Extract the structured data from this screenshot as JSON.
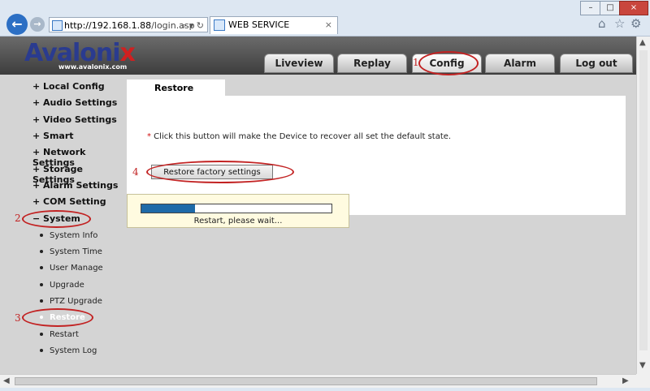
{
  "browser": {
    "url_host": "http://192.168.1.88",
    "url_path": "/login.asp",
    "address_controls": "⌕ ▾ ↻",
    "tab_title": "WEB SERVICE",
    "tab_close": "×",
    "window_controls": [
      "–",
      "□",
      "×"
    ],
    "toolbar_icons": [
      "home-icon",
      "star-icon",
      "gear-icon"
    ]
  },
  "header": {
    "logo_main": "Avaloni",
    "logo_x": "x",
    "logo_url": "www.avalonix.com",
    "tabs": [
      "Liveview",
      "Replay",
      "Config",
      "Alarm",
      "Log out"
    ]
  },
  "sidebar": {
    "menu": [
      "+ Local Config",
      "+ Audio Settings",
      "+ Video Settings",
      "+ Smart",
      "+ Network Settings",
      "+ Storage Settings",
      "+ Alarm Settings",
      "+ COM Setting",
      "− System"
    ],
    "submenu": [
      "System Info",
      "System Time",
      "User Manage",
      "Upgrade",
      "PTZ Upgrade",
      "Restore",
      "Restart",
      "System Log"
    ]
  },
  "main": {
    "tab": "Restore",
    "note_star": "*",
    "note": " Click this button will make the Device to recover all set the default state.",
    "button": "Restore factory settings"
  },
  "popup": {
    "progress": 0.28,
    "text": "Restart, please wait..."
  },
  "annotations": [
    "1",
    "2",
    "3",
    "4"
  ],
  "colors": {
    "annotation": "#c22222",
    "progress": "#1e6aa8"
  }
}
